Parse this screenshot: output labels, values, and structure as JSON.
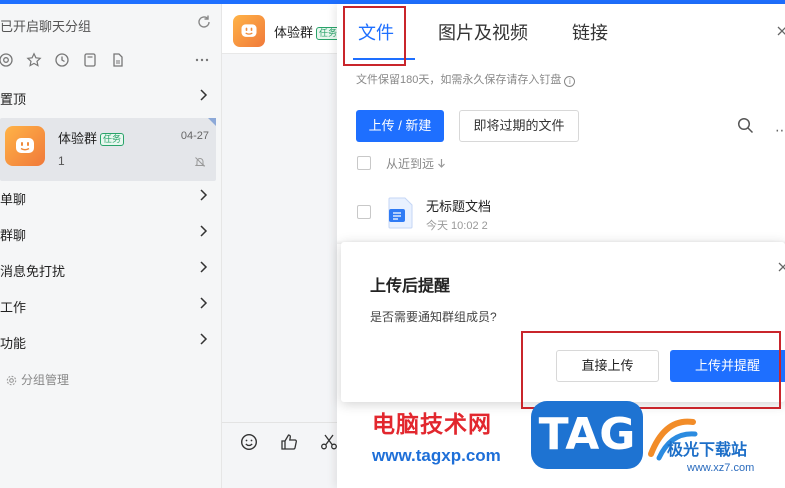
{
  "colors": {
    "accent": "#1e6fff",
    "annotation": "#c9252b",
    "sidebar_bg": "#f5f6f7"
  },
  "sidebar": {
    "header": "已开启聊天分组",
    "filter_icons": [
      "at-icon",
      "star-icon",
      "clock-icon",
      "doc-icon",
      "file-icon",
      "more-icon"
    ],
    "sections": [
      {
        "label": "置顶"
      },
      {
        "label": "单聊"
      },
      {
        "label": "群聊"
      },
      {
        "label": "消息免打扰"
      },
      {
        "label": "工作"
      },
      {
        "label": "功能"
      }
    ],
    "conversation": {
      "name": "体验群",
      "badge": "任务",
      "date": "04-27",
      "count": "1"
    },
    "manage": "分组管理"
  },
  "chat": {
    "name": "体验群",
    "badge": "任务"
  },
  "file_panel": {
    "tabs": [
      {
        "label": "文件"
      },
      {
        "label": "图片及视频"
      },
      {
        "label": "链接"
      }
    ],
    "notice": "文件保留180天，如需永久保存请存入钉盘",
    "upload_button": "上传 / 新建",
    "expiring_button": "即将过期的文件",
    "sort_label": "从近到远",
    "file": {
      "name": "无标题文档",
      "time": "今天 10:02",
      "count": "2"
    }
  },
  "dialog": {
    "title": "上传后提醒",
    "body": "是否需要通知群组成员?",
    "direct_button": "直接上传",
    "remind_button": "上传并提醒"
  },
  "watermark": {
    "cn_text": "电脑技术网",
    "url_text": "www.tagxp.com",
    "tag_text": "TAG",
    "site_name": "极光下载站",
    "site_url": "www.xz7.com"
  }
}
